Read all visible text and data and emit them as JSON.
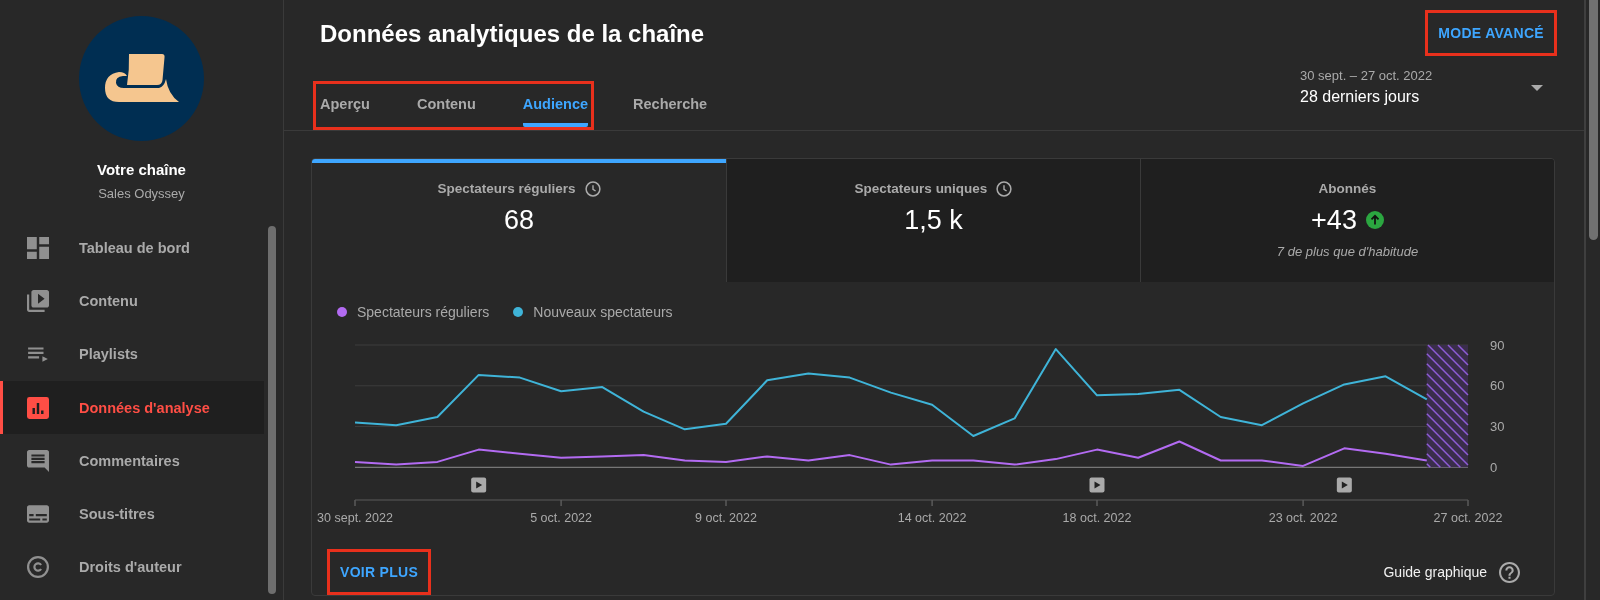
{
  "sidebar": {
    "channel": {
      "title": "Votre chaîne",
      "name": "Sales Odyssey"
    },
    "items": [
      {
        "label": "Tableau de bord",
        "selected": false
      },
      {
        "label": "Contenu",
        "selected": false
      },
      {
        "label": "Playlists",
        "selected": false
      },
      {
        "label": "Données d'analyse",
        "selected": true
      },
      {
        "label": "Commentaires",
        "selected": false
      },
      {
        "label": "Sous-titres",
        "selected": false
      },
      {
        "label": "Droits d'auteur",
        "selected": false
      }
    ]
  },
  "header": {
    "title": "Données analytiques de la chaîne",
    "advanced_mode_button": {
      "label": "MODE AVANCÉ",
      "highlighted": true
    },
    "tabs": {
      "items": [
        {
          "label": "Aperçu",
          "selected": false,
          "highlighted": true
        },
        {
          "label": "Contenu",
          "selected": false,
          "highlighted": true
        },
        {
          "label": "Audience",
          "selected": true,
          "highlighted": true
        },
        {
          "label": "Recherche",
          "selected": false,
          "highlighted": false
        }
      ]
    },
    "date_range": {
      "dates": "30 sept. – 27 oct. 2022",
      "period": "28 derniers jours"
    }
  },
  "metrics": [
    {
      "kind": "pending",
      "label": "Spectateurs réguliers",
      "value": "68",
      "selected": true
    },
    {
      "kind": "pending",
      "label": "Spectateurs uniques",
      "value": "1,5 k",
      "selected": false
    },
    {
      "kind": "rising",
      "label": "Abonnés",
      "value": "+43",
      "note": "7 de plus que d'habitude",
      "selected": false
    }
  ],
  "chart": {
    "chart_data": {
      "type": "line",
      "categories": [
        "30 sept. 2022",
        null,
        null,
        null,
        null,
        "5 oct. 2022",
        null,
        null,
        null,
        "9 oct. 2022",
        null,
        null,
        null,
        null,
        "14 oct. 2022",
        null,
        null,
        null,
        "18 oct. 2022",
        null,
        null,
        null,
        null,
        "23 oct. 2022",
        null,
        null,
        null,
        "27 oct. 2022"
      ],
      "series": [
        {
          "name": "Spectateurs réguliers",
          "color": "#b36bf2",
          "values": [
            4,
            2,
            4,
            13,
            10,
            7,
            8,
            9,
            5,
            4,
            8,
            5,
            9,
            2,
            5,
            5,
            2,
            6,
            13,
            7,
            19,
            5,
            5,
            1,
            14,
            10,
            5,
            null
          ]
        },
        {
          "name": "Nouveaux spectateurs",
          "color": "#3fb4d8",
          "values": [
            33,
            31,
            37,
            68,
            66,
            56,
            59,
            41,
            28,
            32,
            64,
            69,
            66,
            55,
            46,
            23,
            36,
            87,
            53,
            54,
            57,
            37,
            31,
            47,
            61,
            67,
            50,
            null
          ]
        }
      ],
      "ylim": [
        0,
        90
      ],
      "yticks": [
        0,
        30,
        60,
        90
      ]
    }
  },
  "footer": {
    "see_more_button": {
      "label": "VOIR PLUS",
      "highlighted": true
    },
    "guide_link": {
      "label": "Guide graphique"
    }
  }
}
